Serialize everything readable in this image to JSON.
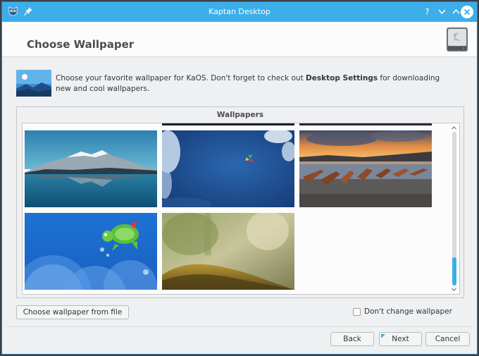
{
  "window": {
    "title": "Kaptan Desktop",
    "accent": "#3daee9"
  },
  "titlebar_icons": {
    "app": "kaptan-owl-icon",
    "pin": "pin-icon",
    "help": "help-icon",
    "minimize": "minimize-icon",
    "maximize": "maximize-icon",
    "close": "close-icon"
  },
  "header": {
    "title": "Choose Wallpaper",
    "icon": "drive-icon"
  },
  "intro": {
    "text_before": "Choose your favorite wallpaper for KaOS. Don't forget to check out ",
    "bold_link": "Desktop Settings",
    "text_after": " for downloading new and cool wallpapers."
  },
  "gallery": {
    "title": "Wallpapers",
    "wallpapers": [
      {
        "name": "mountain-lake"
      },
      {
        "name": "blue-sky-clouds"
      },
      {
        "name": "boats-sunset"
      },
      {
        "name": "kaos-turtle-blue"
      },
      {
        "name": "blurred-moss-green"
      }
    ],
    "scroll_position": 0.85
  },
  "buttons": {
    "choose_file": "Choose wallpaper from file",
    "back": "Back",
    "next": "Next",
    "cancel": "Cancel"
  },
  "options": {
    "dont_change_label": "Don't change wallpaper",
    "dont_change_checked": false
  }
}
